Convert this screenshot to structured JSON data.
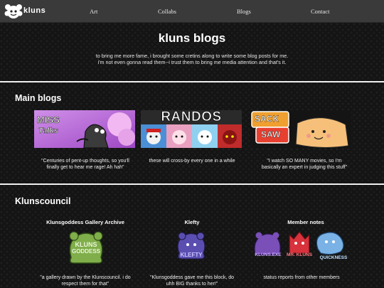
{
  "site": {
    "logo_text": "kluns"
  },
  "nav": {
    "items": [
      "Art",
      "Collabs",
      "Blogs",
      "Contact"
    ]
  },
  "hero": {
    "title": "kluns blogs",
    "line1": "to bring me more fame, i brought some cretins along to write some blog posts for me.",
    "line2": "i'm not even gonna read them--i trust them to bring me media attention and that's it."
  },
  "main_blogs": {
    "title": "Main blogs",
    "items": [
      {
        "banner_line1": "MISS",
        "banner_line2": "Talks",
        "caption1": "\"Centuries of pent-up thoughts, so you'll",
        "caption2": "finally get to hear me rage! Ah hah\""
      },
      {
        "banner_line1": "RANDOS",
        "caption1": "these will cross-by every one in a while"
      },
      {
        "banner_line1": "SACK",
        "banner_line2": "SAW",
        "caption1": "\"I watch SO MANY movies, so I'm",
        "caption2": "basically an expert in judging this stuff\""
      }
    ]
  },
  "council": {
    "title": "Klunscouncil",
    "items": [
      {
        "title": "Klunsgoddess Gallery Archive",
        "art_line1": "KLUNS",
        "art_line2": "GODDESS",
        "caption1": "\"a gallery drawn by the Klunscouncil. i do",
        "caption2": "respect them for that\""
      },
      {
        "title": "Klefty",
        "art_line1": "KLEFTY",
        "caption1": "\"Klunsgoddess gave me this block, do",
        "caption2": "uhh BIG thanks to her!\""
      },
      {
        "title": "Member notes",
        "art_labels": [
          "KLUNS.EXE",
          "MR. KLUNS",
          "QUICKNESS"
        ],
        "caption1": "status reports from other members"
      }
    ]
  },
  "colors": {
    "nav_bg": "#3a3a3a",
    "page_bg": "#141414",
    "goddess_green": "#7fae4a",
    "klefty_purple": "#5a4fb0",
    "exe_purple": "#7a4fb8",
    "mr_red": "#d8323c",
    "quick_blue": "#7ab2e6"
  }
}
